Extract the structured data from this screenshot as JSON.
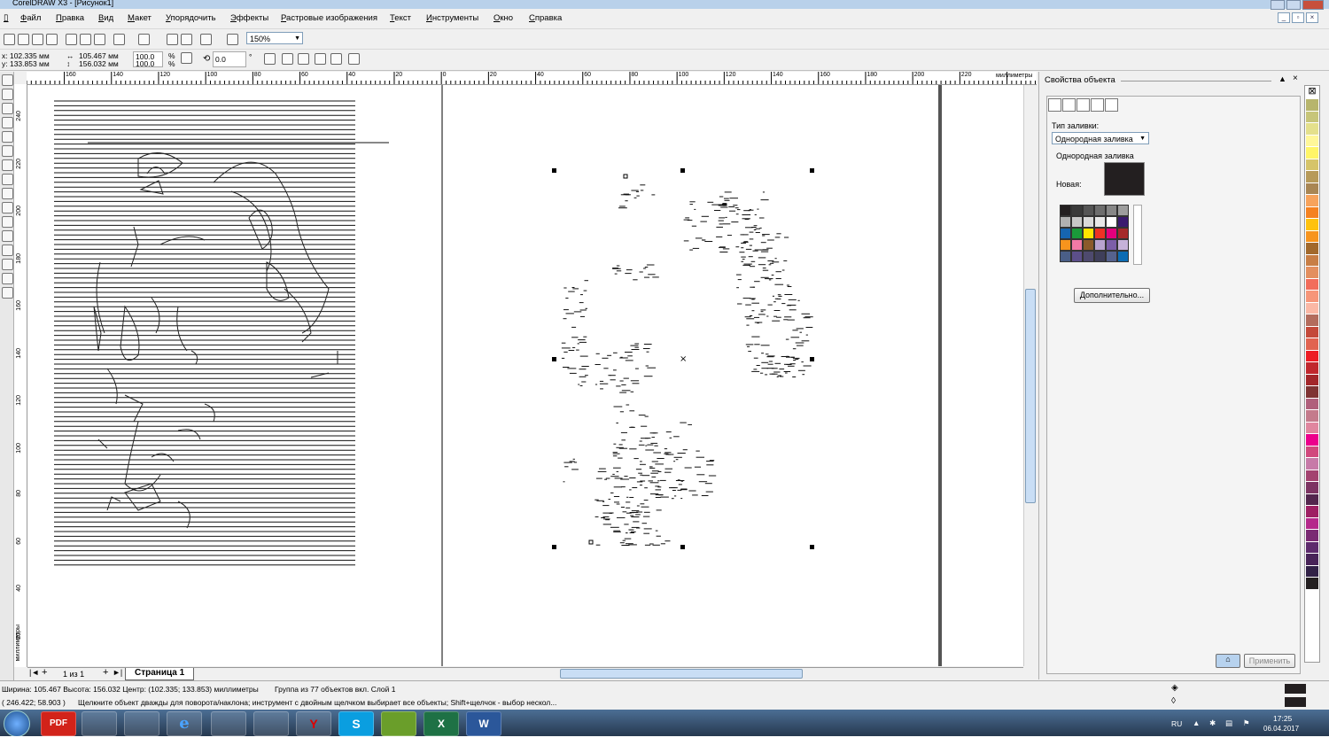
{
  "window": {
    "title": "CorelDRAW X3 - [Рисунок1]"
  },
  "menu": [
    "Файл",
    "Правка",
    "Вид",
    "Макет",
    "Упорядочить",
    "Эффекты",
    "Растровые изображения",
    "Текст",
    "Инструменты",
    "Окно",
    "Справка"
  ],
  "toolbar": {
    "zoom": "150%"
  },
  "propbar": {
    "x": "x: 102.335 мм",
    "y": "y: 133.853 мм",
    "width": "105.467 мм",
    "height": "156.032 мм",
    "scale_w": "100.0",
    "scale_h": "100.0",
    "pct1": "%",
    "pct2": "%",
    "rotation": "0.0",
    "degree": "°"
  },
  "ruler": {
    "top_ticks": [
      "160",
      "140",
      "120",
      "100",
      "80",
      "60",
      "40",
      "20",
      "0",
      "20",
      "40",
      "60",
      "80",
      "100",
      "120",
      "140",
      "160",
      "180",
      "200",
      "220"
    ],
    "units": "миллиметры",
    "left_ticks": [
      "240",
      "220",
      "200",
      "180",
      "160",
      "140",
      "120",
      "100",
      "80",
      "60",
      "40",
      "20"
    ],
    "left_units": "миллиметры"
  },
  "page_nav": {
    "counter": "1 из 1",
    "page_tab": "Страница 1"
  },
  "docker": {
    "title": "Свойства объекта",
    "fill_type_label": "Тип заливки:",
    "fill_type_value": "Однородная заливка",
    "group_label": "Однородная заливка",
    "new_label": "Новая:",
    "more_button": "Дополнительно...",
    "apply_button": "Применить"
  },
  "colors": {
    "new_fill": "#231f20",
    "palette_grid": [
      "#231f20",
      "#3a3a3a",
      "#555555",
      "#6d6d6d",
      "#878787",
      "#9d9d9d",
      "#b1b1b1",
      "#c8c8c8",
      "#dadada",
      "#e8e8e8",
      "#ffffff",
      "#3a1a6e",
      "#1665b0",
      "#1a9a3a",
      "#ffe400",
      "#ee3124",
      "#e4007c",
      "#a52a2a",
      "#f7941d",
      "#f27aa6",
      "#8b5a2b",
      "#b9a3cf",
      "#7c5ea8",
      "#c6b2d9",
      "#4a5e87",
      "#5c4f8a",
      "#4e4a6e",
      "#3f3f5a",
      "#56628d",
      "#0d6cb3"
    ],
    "color_bar": [
      "#ffffff",
      "#b7b56d",
      "#c7c579",
      "#e4e08c",
      "#fff799",
      "#fff568",
      "#d6c46a",
      "#b79a59",
      "#a98654",
      "#f7a35c",
      "#f58220",
      "#ffc20e",
      "#f7941d",
      "#a2692c",
      "#c87e45",
      "#e38f5f",
      "#f26d5c",
      "#f69679",
      "#fbb8a5",
      "#b36c5d",
      "#c4493a",
      "#e16350",
      "#ed1c24",
      "#c1272d",
      "#a3262a",
      "#7f3333",
      "#b0607c",
      "#c47b8c",
      "#e0869f",
      "#ec008c",
      "#d1487d",
      "#c77aa8",
      "#a3426f",
      "#7d3463",
      "#53264e",
      "#9e1f63",
      "#b5298b",
      "#7a2a73",
      "#5d2a6c",
      "#482358",
      "#312146",
      "#231f20"
    ]
  },
  "status": {
    "line1": "Ширина: 105.467 Высота: 156.032 Центр: (102.335; 133.853) миллиметры",
    "line1b": "Группа из 77 объектов вкл. Слой 1",
    "line2_coords": "( 246.422; 58.903 )",
    "line2_hint": "Щелкните объект дважды для поворота/наклона; инструмент с двойным щелчком выбирает все объекты; Shift+щелчок - выбор нескол..."
  },
  "taskbar": {
    "apps": [
      "PDF",
      "",
      "",
      "e",
      "",
      "",
      "Y",
      "S",
      "",
      "X",
      "W"
    ],
    "lang": "RU",
    "time": "17:25",
    "date": "06.04.2017"
  }
}
